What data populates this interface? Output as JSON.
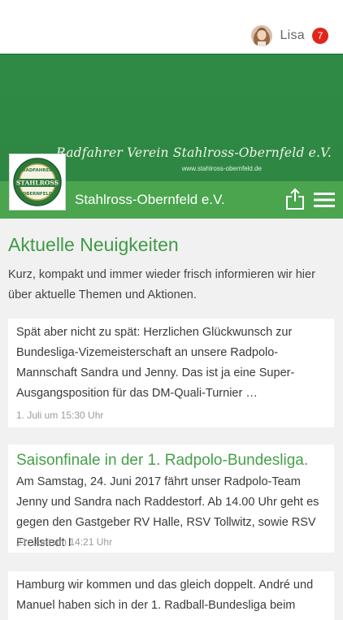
{
  "header": {
    "user_name": "Lisa",
    "notification_count": "7"
  },
  "banner": {
    "club_name": "Radfahrer Verein Stahlross-Obernfeld e.V.",
    "website": "www.stahlross-obernfeld.de",
    "logo_text_top": "RADFAHRER",
    "logo_text_middle": "STAHLROSS",
    "logo_text_bottom": "OBERNFELD"
  },
  "navbar": {
    "title": "Stahlross-Obernfeld e.V.",
    "share_icon": "share-icon",
    "menu_icon": "hamburger-menu-icon"
  },
  "main": {
    "title": "Aktuelle Neuigkeiten",
    "intro": "Kurz, kompakt und immer wieder frisch informieren wir hier über aktuelle Themen und Aktionen.",
    "posts": [
      {
        "headline": "",
        "text": "Spät aber nicht zu spät: Herzlichen Glückwunsch zur Bundesliga-Vizemeisterschaft an unsere Radpolo-Mannschaft Sandra und Jenny. Das ist ja eine Super-Ausgangsposition für das DM-Quali-Turnier …",
        "date": "1. Juli um 15:30 Uhr"
      },
      {
        "headline": "Saisonfinale in der 1. Radpolo-Bundesliga.",
        "text": "Am Samstag, 24. Juni 2017 fährt unser Radpolo-Team Jenny und Sandra nach Raddestorf. Ab 14.00 Uhr geht es gegen den Gastgeber RV Halle, RSV Tollwitz, sowie RSV Frellstedt I",
        "date": "21. Juni um 14:21 Uhr"
      },
      {
        "headline": "",
        "text": "Hamburg wir kommen und das gleich doppelt. André und Manuel haben sich in der 1. Radball-Bundesliga beim",
        "date": ""
      }
    ]
  },
  "colors": {
    "brand_green": "#2f8a46",
    "nav_green": "#4aa54e",
    "badge_red": "#e0251b"
  }
}
